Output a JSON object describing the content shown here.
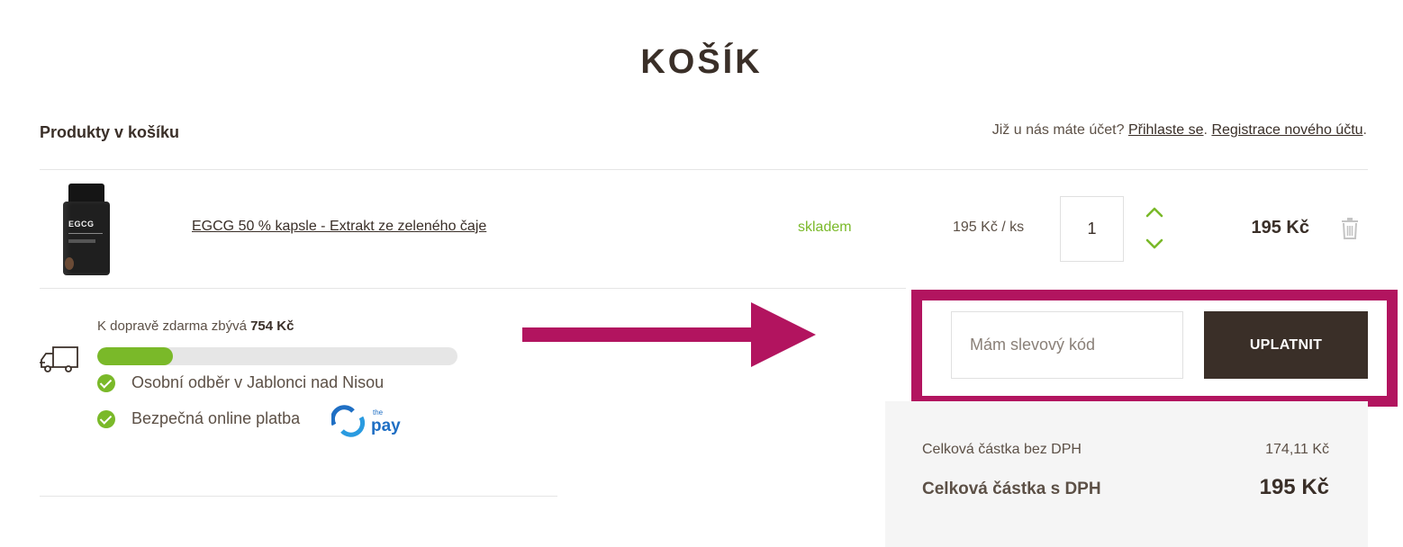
{
  "page": {
    "title": "KOŠÍK"
  },
  "cart": {
    "section_title": "Produkty v košíku"
  },
  "account": {
    "prompt": "Již u nás máte účet?",
    "login_link": "Přihlaste se",
    "separator": ".",
    "register_link": "Registrace nového účtu",
    "end": "."
  },
  "product": {
    "name": "EGCG 50 % kapsle - Extrakt ze zeleného čaje",
    "thumb_label": "EGCG",
    "stock": "skladem",
    "unit_price": "195 Kč / ks",
    "quantity": "1",
    "total": "195 Kč"
  },
  "shipping": {
    "free_text": "K dopravě zdarma zbývá",
    "free_amount": "754 Kč",
    "progress_fraction": 0.21
  },
  "features": [
    {
      "label": "Osobní odběr v Jablonci nad Nisou"
    },
    {
      "label": "Bezpečná online platba"
    }
  ],
  "payment_logo": {
    "small": "the",
    "big": "pay"
  },
  "coupon": {
    "placeholder": "Mám slevový kód",
    "apply_label": "UPLATNIT"
  },
  "totals": {
    "net_label": "Celková částka bez DPH",
    "net_value": "174,11 Kč",
    "gross_label": "Celková částka s DPH",
    "gross_value": "195 Kč"
  },
  "colors": {
    "brand_dark": "#3a2f28",
    "accent_green": "#7ab929",
    "highlight_magenta": "#b2145f"
  }
}
